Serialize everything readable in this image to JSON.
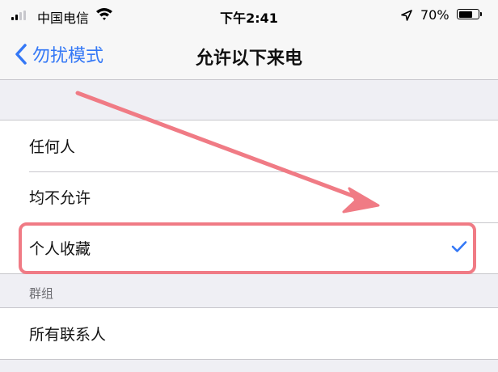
{
  "status_bar": {
    "carrier": "中国电信",
    "time": "下午2:41",
    "battery_percent": "70%",
    "battery_level": 0.7,
    "signal_bars": 4,
    "signal_strength": 2
  },
  "nav": {
    "back_label": "勿扰模式",
    "title": "允许以下来电"
  },
  "options": [
    {
      "label": "任何人",
      "selected": false
    },
    {
      "label": "均不允许",
      "selected": false
    },
    {
      "label": "个人收藏",
      "selected": true
    }
  ],
  "groups": {
    "header": "群组",
    "items": [
      {
        "label": "所有联系人"
      }
    ]
  },
  "colors": {
    "accent": "#3478f6",
    "annotation": "#f07b85",
    "background": "#efeff4"
  },
  "icons": [
    "signal-icon",
    "wifi-icon",
    "location-icon",
    "battery-icon",
    "chevron-left-icon",
    "checkmark-icon",
    "annotation-arrow"
  ]
}
